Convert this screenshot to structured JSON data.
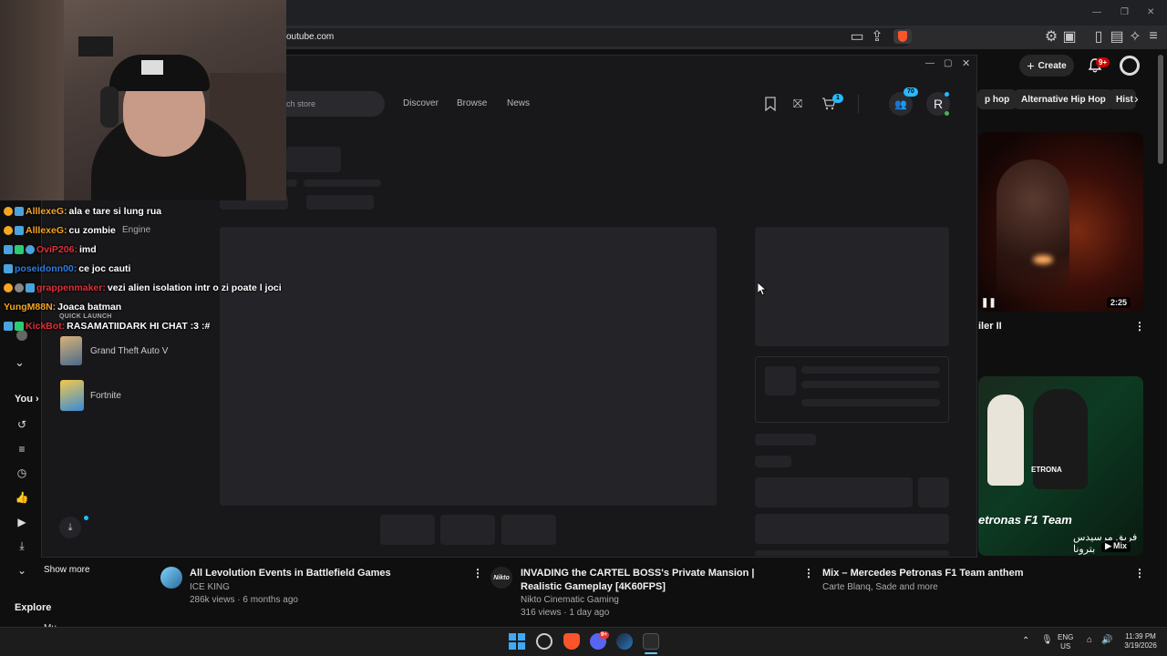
{
  "browser": {
    "url": "outube.com"
  },
  "youtube": {
    "create_label": "Create",
    "notif_count": "9+",
    "chips": [
      "p hop",
      "Alternative Hip Hop",
      "Hist"
    ],
    "right_video_1": {
      "duration": "2:25",
      "title": "iler II"
    },
    "right_video_2": {
      "badge": "Mix",
      "overlay_title": "etronas F1 Team",
      "overlay_sub": "فريق مرسيدس بترونا",
      "logo_text": "ETRONA"
    },
    "sidebar": {
      "you_label": "You",
      "show_more": "Show more",
      "explore": "Explore",
      "partial_item": "Mu"
    },
    "bottom_videos": [
      {
        "title": "All Levolution Events in Battlefield Games",
        "channel": "ICE KING",
        "meta": "286k views · 6 months ago",
        "avatar": ""
      },
      {
        "title": "INVADING the CARTEL BOSS's Private Mansion | Realistic Gameplay [4K60FPS]",
        "channel": "Nikto Cinematic Gaming",
        "meta": "316 views · 1 day ago",
        "avatar": "Nikto"
      },
      {
        "title": "Mix – Mercedes Petronas F1 Team anthem",
        "channel": "Carte Blanq, Sade and more",
        "meta": "",
        "avatar": ""
      }
    ]
  },
  "launcher": {
    "search_placeholder": "ch store",
    "nav": [
      "Discover",
      "Browse",
      "News"
    ],
    "cart_count": "1",
    "friends_count": "70",
    "avatar_initial": "R",
    "left_items": {
      "engine": "Engine",
      "quick_launch": "QUICK LAUNCH",
      "games": [
        "Grand Theft Auto V",
        "Fortnite"
      ]
    }
  },
  "chat": [
    {
      "user": "AlllexeG:",
      "msg": "ala e tare si lung rua",
      "color": "#f5a623"
    },
    {
      "user": "AlllexeG:",
      "msg": "cu zombie",
      "color": "#f5a623"
    },
    {
      "user": "OviP206:",
      "msg": "imd",
      "color": "#e0303a"
    },
    {
      "user": "poseidonn00:",
      "msg": "ce joc cauti",
      "color": "#2f7de1"
    },
    {
      "user": "grappenmaker:",
      "msg": "vezi alien isolation intr o zi poate l joci",
      "color": "#e0303a"
    },
    {
      "user": "YungM88N:",
      "msg": "Joaca batman",
      "color": "#f5a623"
    },
    {
      "user": "KickBot:",
      "msg": "RASAMATIIDARK HI CHAT :3 :#",
      "color": "#e0303a"
    }
  ],
  "taskbar": {
    "lang_1": "ENG",
    "lang_2": "US",
    "time": "11:39 PM",
    "date": "3/19/2026",
    "discord_badge": "9+"
  }
}
